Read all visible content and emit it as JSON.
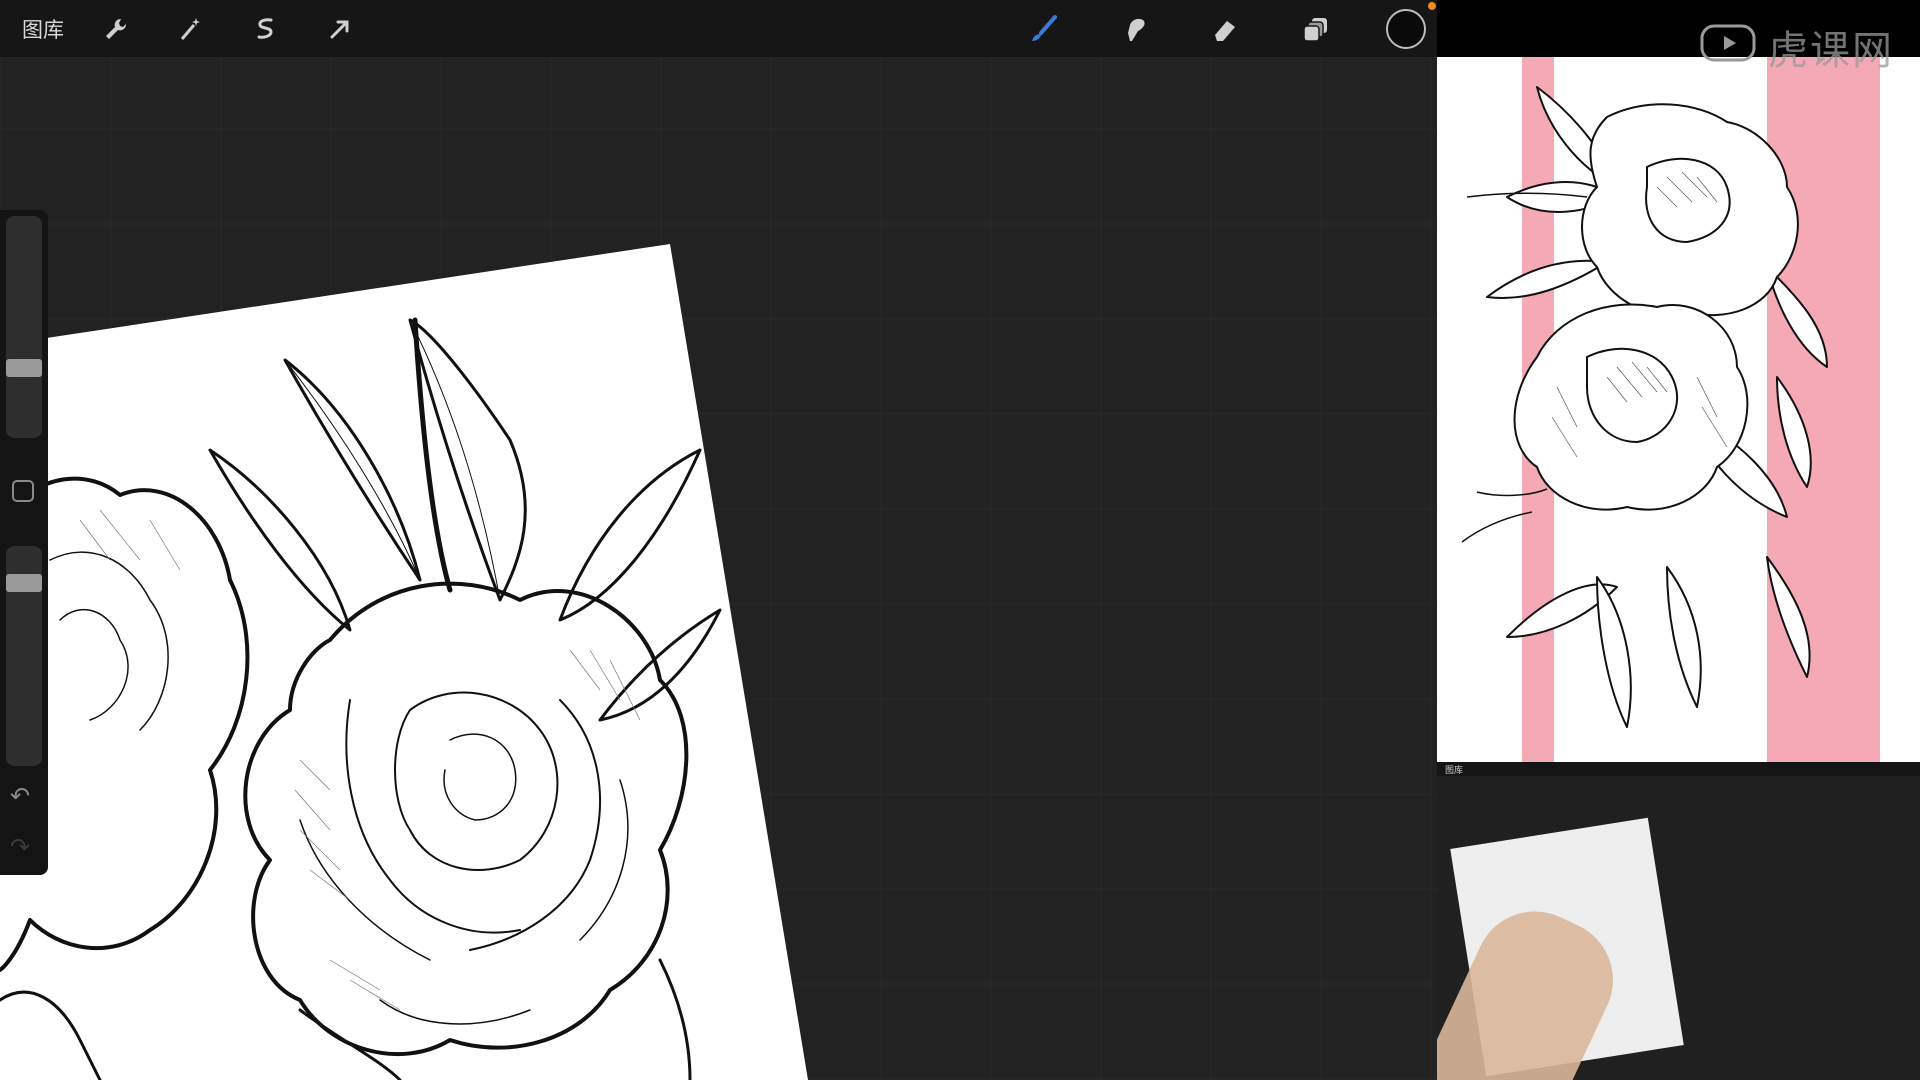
{
  "topbar": {
    "gallery_label": "图库",
    "tools": [
      {
        "name": "wrench-icon"
      },
      {
        "name": "magic-wand-icon"
      },
      {
        "name": "selection-icon"
      },
      {
        "name": "transform-arrow-icon"
      },
      {
        "name": "brush-icon",
        "active_color": "#3a7bd5"
      },
      {
        "name": "smudge-icon"
      },
      {
        "name": "eraser-icon"
      },
      {
        "name": "layers-icon"
      }
    ],
    "color_well": "#0a0a0a",
    "notify_dot": "#f08a1c"
  },
  "sidebar": {
    "size_slider_level": 0.62,
    "opacity_slider_level": 0.12,
    "undo_icon": "undo-icon",
    "redo_icon": "redo-icon"
  },
  "watermark": {
    "text": "虎课网"
  },
  "reference": {
    "stripe_color": "#f4a9b4"
  },
  "mini_video": {
    "gallery_label": "图库"
  }
}
